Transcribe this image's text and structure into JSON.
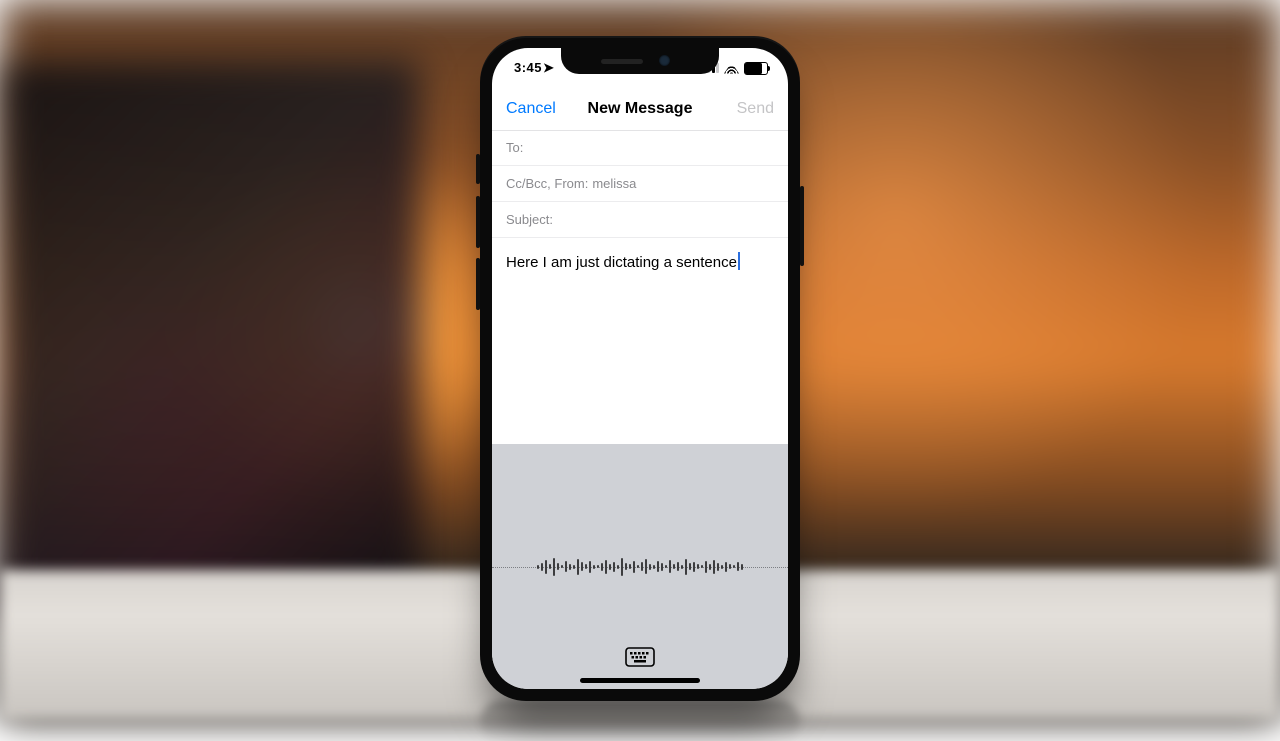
{
  "status": {
    "time": "3:45",
    "location_glyph": "➤"
  },
  "nav": {
    "cancel": "Cancel",
    "title": "New Message",
    "send": "Send"
  },
  "fields": {
    "to_label": "To:",
    "ccbcc_label": "Cc/Bcc, From:",
    "from_value": "melissa",
    "subject_label": "Subject:"
  },
  "body_text": "Here I am just dictating a sentence",
  "waveform_heights": [
    4,
    8,
    14,
    5,
    18,
    7,
    3,
    11,
    6,
    4,
    16,
    9,
    5,
    12,
    4,
    3,
    8,
    14,
    6,
    10,
    4,
    18,
    7,
    5,
    12,
    3,
    9,
    15,
    6,
    4,
    11,
    8,
    3,
    13,
    5,
    9,
    4,
    16,
    7,
    10,
    5,
    3,
    12,
    6,
    14,
    8,
    4,
    10,
    5,
    3,
    9,
    6
  ]
}
